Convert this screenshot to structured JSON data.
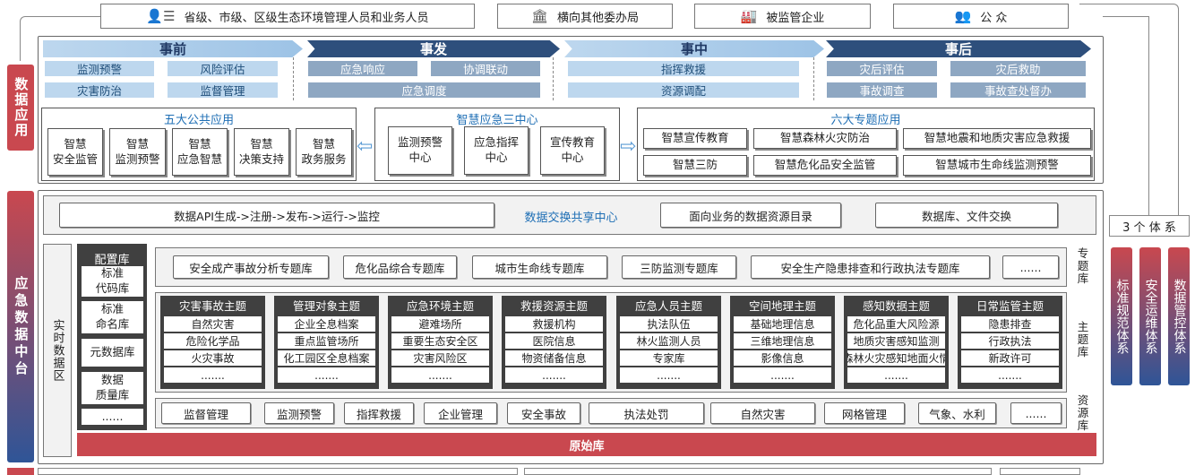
{
  "users": [
    {
      "label": "省级、市级、区级生态环境管理人员和业务人员",
      "icon": "person-list-icon"
    },
    {
      "label": "横向其他委办局",
      "icon": "building-icon"
    },
    {
      "label": "被监管企业",
      "icon": "factory-icon"
    },
    {
      "label": "公 众",
      "icon": "people-icon"
    }
  ],
  "left_labels": {
    "app": "数据应用",
    "middle": "应急数据中台"
  },
  "phases": [
    {
      "title": "事前",
      "items": [
        "监测预警",
        "风险评估",
        "灾害防治",
        "监督管理"
      ]
    },
    {
      "title": "事发",
      "items": [
        "应急响应",
        "协调联动",
        "应急调度"
      ]
    },
    {
      "title": "事中",
      "items": [
        "指挥救援",
        "资源调配"
      ]
    },
    {
      "title": "事后",
      "items": [
        "灾后评估",
        "灾后救助",
        "事故调查",
        "事故查处督办"
      ]
    }
  ],
  "public_apps": {
    "title": "五大公共应用",
    "items": [
      "智慧\n安全监管",
      "智慧\n监测预警",
      "智慧\n应急智慧",
      "智慧\n决策支持",
      "智慧\n政务服务"
    ]
  },
  "centers": {
    "title": "智慧应急三中心",
    "items": [
      "监测预警\n中心",
      "应急指挥\n中心",
      "宣传教育\n中心"
    ]
  },
  "special_apps": {
    "title": "六大专题应用",
    "items": [
      "智慧宣传教育",
      "智慧森林火灾防治",
      "智慧地震和地质灾害应急救援",
      "智慧三防",
      "智慧危化品安全监管",
      "智慧城市生命线监测预警"
    ]
  },
  "exchange": {
    "api": "数据API生成->注册->发布->运行->监控",
    "center": "数据交换共享中心",
    "catalog": "面向业务的数据资源目录",
    "db": "数据库、文件交换"
  },
  "realtime": "实时数据区",
  "config": {
    "title": "配置库",
    "items": [
      "标准\n代码库",
      "标准\n命名库",
      "元数据库",
      "数据\n质量库",
      "......"
    ]
  },
  "special_db": {
    "label": "专题库",
    "items": [
      "安全成产事故分析专题库",
      "危化品综合专题库",
      "城市生命线专题库",
      "三防监测专题库",
      "安全生产隐患排查和行政执法专题库",
      "......"
    ]
  },
  "theme_db": {
    "label": "主题库",
    "groups": [
      {
        "title": "灾害事故主题",
        "items": [
          "自然灾害",
          "危险化学品",
          "火灾事故",
          "......."
        ]
      },
      {
        "title": "管理对象主题",
        "items": [
          "企业全息档案",
          "重点监管场所",
          "化工园区全息档案",
          "......."
        ]
      },
      {
        "title": "应急环境主题",
        "items": [
          "避难场所",
          "重要生态安全区",
          "灾害风险区",
          "......."
        ]
      },
      {
        "title": "救援资源主题",
        "items": [
          "救援机构",
          "医院信息",
          "物资储备信息",
          "......."
        ]
      },
      {
        "title": "应急人员主题",
        "items": [
          "执法队伍",
          "林火监测人员",
          "专家库",
          "......."
        ]
      },
      {
        "title": "空间地理主题",
        "items": [
          "基础地理信息",
          "三维地理信息",
          "影像信息",
          "......."
        ]
      },
      {
        "title": "感知数据主题",
        "items": [
          "危化品重大风险源",
          "地质灾害感知监测",
          "森林火灾感知地面火情",
          "......."
        ]
      },
      {
        "title": "日常监管主题",
        "items": [
          "隐患排查",
          "行政执法",
          "新政许可",
          "......."
        ]
      }
    ]
  },
  "resource_db": {
    "label": "资源库",
    "items": [
      "监督管理",
      "监测预警",
      "指挥救援",
      "企业管理",
      "安全事故",
      "执法处罚",
      "自然灾害",
      "网格管理",
      "气象、水利",
      "......"
    ]
  },
  "raw_db": "原始库",
  "systems": {
    "title": "3 个 体 系",
    "items": [
      "标准规范体系",
      "安全运维体系",
      "数据管控体系"
    ]
  },
  "colors": {
    "red": "#c9484f",
    "blue": "#2f5597",
    "phase_dark": "#2e4f7c",
    "phase_light": "#9dc3e6",
    "gray_box": "#404040"
  }
}
